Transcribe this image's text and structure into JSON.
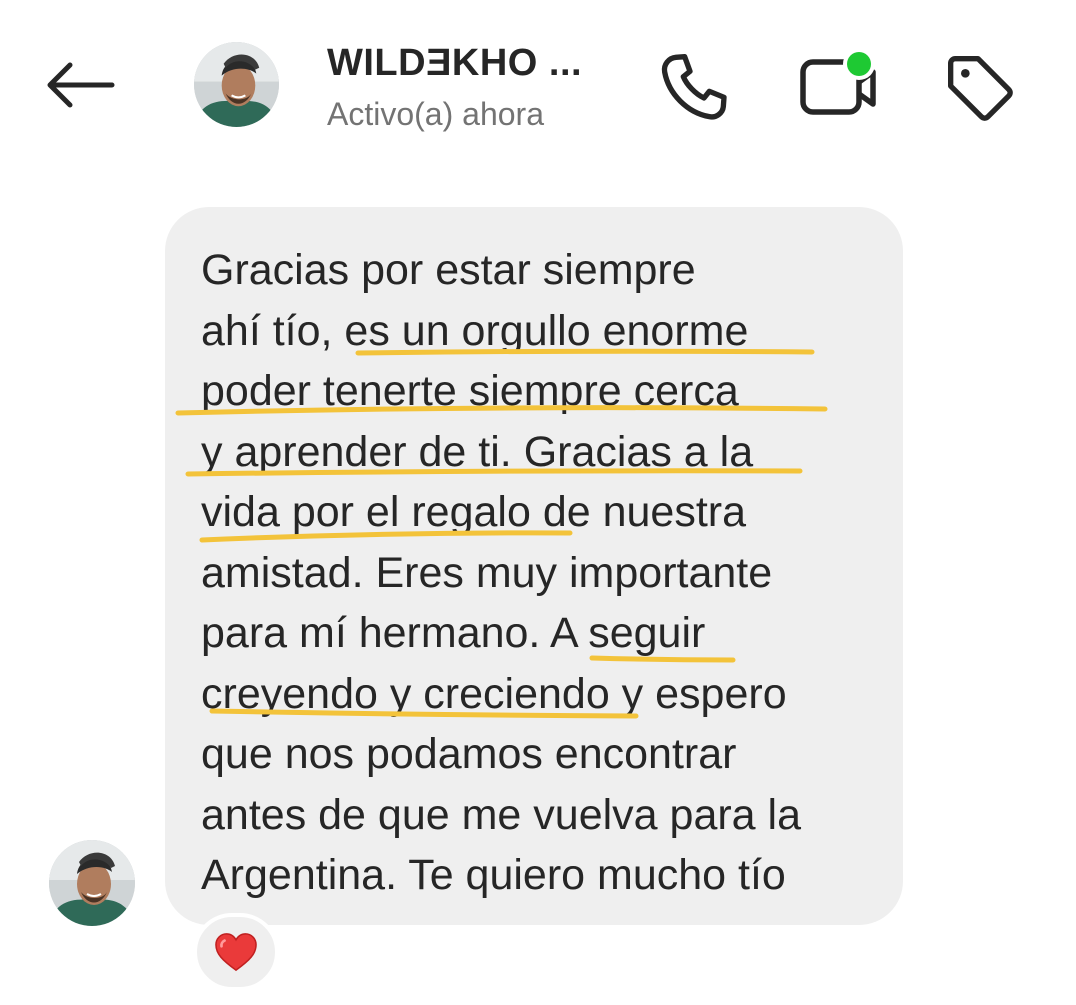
{
  "header": {
    "back_icon": "arrow-left-icon",
    "contact_name": "WILDƎKHO ...",
    "status": "Activo(a) ahora",
    "call_icon": "phone-icon",
    "video_icon": "video-camera-icon",
    "video_indicator_color": "#1ec933",
    "tag_icon": "tag-icon"
  },
  "message": {
    "lines": [
      "Gracias por estar siempre",
      "ahí tío, es un orgullo enorme",
      "poder tenerte siempre cerca",
      "y aprender de ti. Gracias a la",
      "vida por el regalo de nuestra",
      "amistad. Eres muy importante",
      "para mí hermano. A seguir",
      "creyendo y creciendo y espero",
      "que nos podamos encontrar",
      "antes de que me vuelva para la",
      "Argentina. Te quiero mucho tío"
    ],
    "bubble_color": "#efefef",
    "underline_color": "#f3c33a",
    "reaction": "❤️",
    "reaction_icon": "heart-icon"
  },
  "colors": {
    "text": "#262626",
    "secondary_text": "#737373",
    "background": "#ffffff"
  }
}
